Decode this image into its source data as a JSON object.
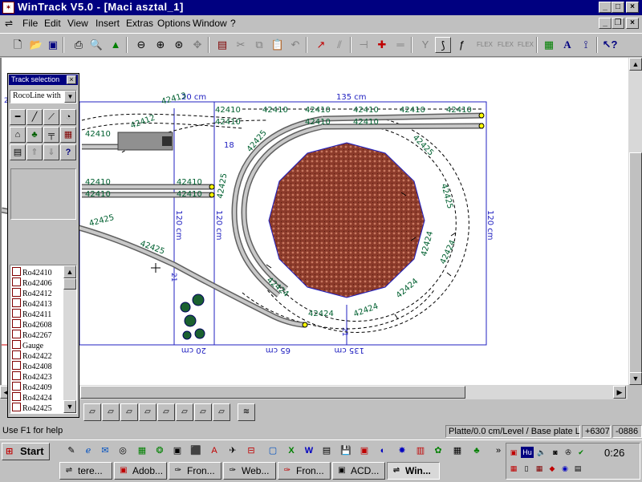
{
  "window": {
    "title": "WinTrack  V5.0 - [Maci asztal_1]"
  },
  "menu": [
    "File",
    "Edit",
    "View",
    "Insert",
    "Extras",
    "Options",
    "Window",
    "?"
  ],
  "track_selection": {
    "title": "Track selection",
    "dropdown_value": "RocoLine with",
    "list": [
      "Ro42410",
      "Ro42406",
      "Ro42412",
      "Ro42413",
      "Ro42411",
      "Ro42608",
      "Ro42267",
      "Gauge",
      "Ro42422",
      "Ro42408",
      "Ro42423",
      "Ro42409",
      "Ro42424",
      "Ro42425"
    ]
  },
  "layout": {
    "dims": {
      "top_left": "20 cm",
      "top_main": "135 cm",
      "left_120": "120 cm",
      "mid_120": "120 cm",
      "right_120": "120 cm",
      "bottom_20": "20 cm",
      "bottom_65": "65 cm",
      "bottom_135": "135 cm",
      "small_18": "18",
      "c21": "21",
      "c21b": "21",
      "c21c": "21"
    },
    "track_labels": [
      "42410",
      "42410",
      "42410",
      "42410",
      "42410",
      "42410",
      "42410",
      "42410",
      "42410",
      "42410",
      "42410",
      "42410",
      "42410",
      "42410",
      "42425",
      "42425",
      "42425",
      "42425",
      "42425",
      "42425",
      "42424",
      "42424",
      "42424",
      "42424",
      "42424",
      "42424",
      "42412",
      "42413"
    ]
  },
  "status": {
    "help": "Use F1 for help",
    "plate": "Platte/0.0 cm/Level / Base plate Le",
    "x": "+6307",
    "y": "-0886"
  },
  "taskbar": {
    "start_label": "Start",
    "tasks": [
      "tere...",
      "Adob...",
      "Fron...",
      "Web...",
      "Fron...",
      "ACD...",
      "Win..."
    ],
    "clock": "0:26",
    "lang": "Hu"
  }
}
